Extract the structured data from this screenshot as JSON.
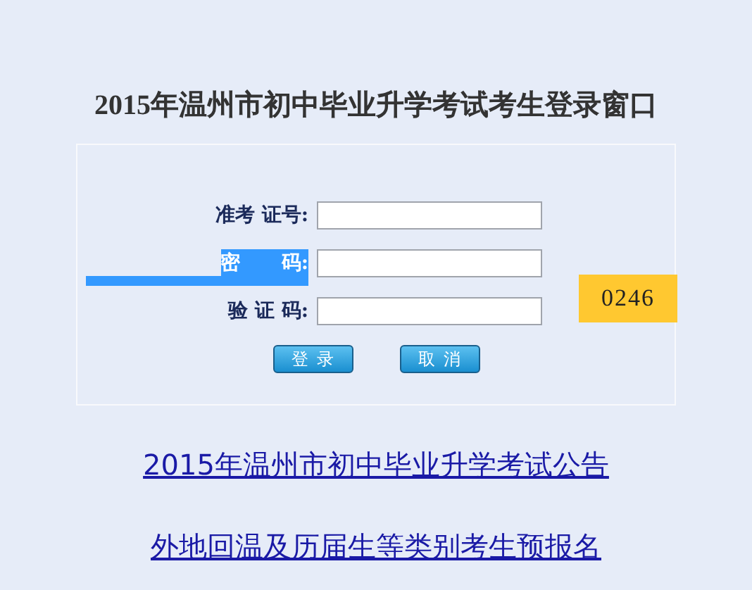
{
  "title": "2015年温州市初中毕业升学考试考生登录窗口",
  "fields": [
    {
      "label": "准考 证号:",
      "highlighted": false
    },
    {
      "label": "密      码:",
      "highlighted": true
    },
    {
      "label": "验 证 码:",
      "highlighted": false
    }
  ],
  "captcha": "0246",
  "buttons": [
    "登 录",
    "取 消"
  ],
  "links": [
    "2015年温州市初中毕业升学考试公告",
    "外地回温及历届生等类别考生预报名"
  ]
}
